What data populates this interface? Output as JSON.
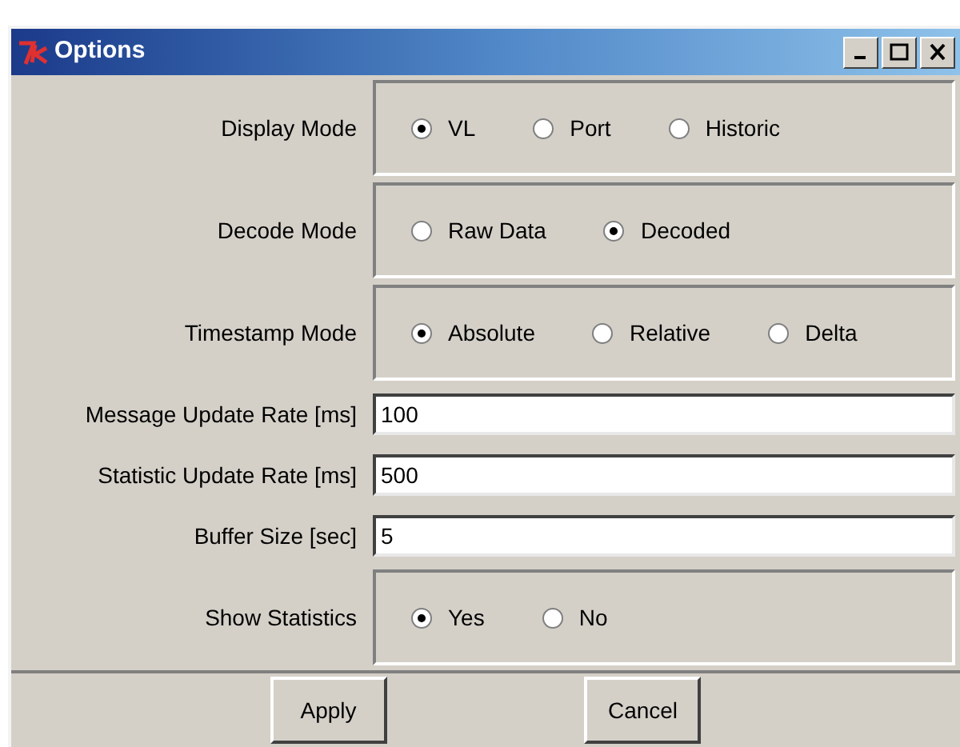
{
  "window": {
    "title": "Options"
  },
  "rows": [
    {
      "kind": "radio",
      "label": "Display Mode",
      "options": [
        {
          "label": "VL",
          "selected": true
        },
        {
          "label": "Port",
          "selected": false
        },
        {
          "label": "Historic",
          "selected": false
        }
      ]
    },
    {
      "kind": "radio",
      "label": "Decode Mode",
      "options": [
        {
          "label": "Raw Data",
          "selected": false
        },
        {
          "label": "Decoded",
          "selected": true
        }
      ]
    },
    {
      "kind": "radio",
      "label": "Timestamp Mode",
      "options": [
        {
          "label": "Absolute",
          "selected": true
        },
        {
          "label": "Relative",
          "selected": false
        },
        {
          "label": "Delta",
          "selected": false
        }
      ]
    },
    {
      "kind": "field",
      "label": "Message Update Rate [ms]",
      "value": "100"
    },
    {
      "kind": "field",
      "label": "Statistic Update Rate [ms]",
      "value": "500"
    },
    {
      "kind": "field",
      "label": "Buffer Size [sec]",
      "value": "5"
    },
    {
      "kind": "radio",
      "label": "Show Statistics",
      "options": [
        {
          "label": "Yes",
          "selected": true
        },
        {
          "label": "No",
          "selected": false
        }
      ]
    }
  ],
  "buttons": [
    "Apply",
    "Cancel"
  ]
}
